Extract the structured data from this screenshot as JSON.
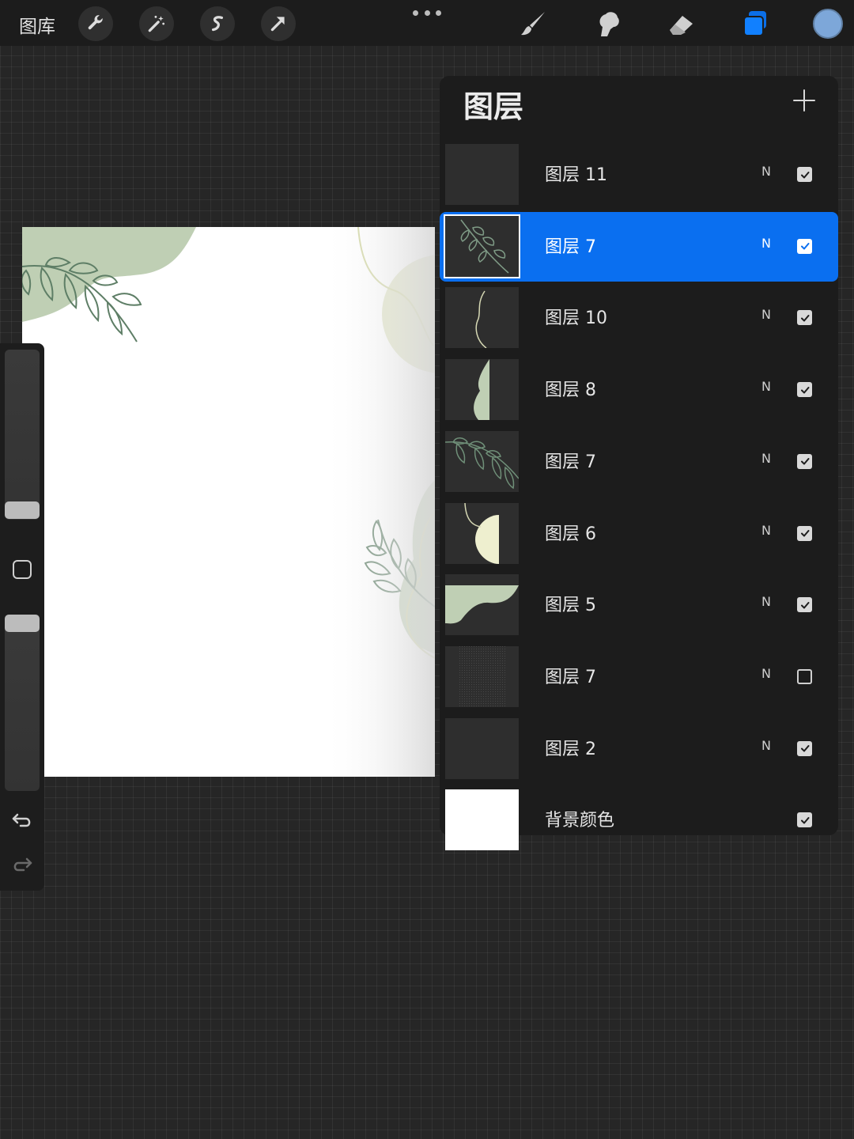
{
  "toolbar": {
    "gallery_label": "图库",
    "tools": [
      "wrench-icon",
      "magic-wand-icon",
      "selection-icon",
      "transform-arrow-icon"
    ],
    "more_icon": "more-dots-icon",
    "right_tools": [
      "brush-icon",
      "smudge-icon",
      "eraser-icon",
      "layers-icon"
    ],
    "current_color": "#7da7d9"
  },
  "layers_panel": {
    "title": "图层",
    "add_icon": "plus-icon",
    "layers": [
      {
        "name": "图层 11",
        "mode": "N",
        "visible": true,
        "selected": false,
        "thumb": "empty"
      },
      {
        "name": "图层 7",
        "mode": "N",
        "visible": true,
        "selected": true,
        "thumb": "leaf-small"
      },
      {
        "name": "图层 10",
        "mode": "N",
        "visible": true,
        "selected": false,
        "thumb": "line"
      },
      {
        "name": "图层 8",
        "mode": "N",
        "visible": true,
        "selected": false,
        "thumb": "shape-half"
      },
      {
        "name": "图层 7",
        "mode": "N",
        "visible": true,
        "selected": false,
        "thumb": "leaves"
      },
      {
        "name": "图层 6",
        "mode": "N",
        "visible": true,
        "selected": false,
        "thumb": "half-moon"
      },
      {
        "name": "图层 5",
        "mode": "N",
        "visible": true,
        "selected": false,
        "thumb": "wave"
      },
      {
        "name": "图层 7",
        "mode": "N",
        "visible": false,
        "selected": false,
        "thumb": "texture"
      },
      {
        "name": "图层 2",
        "mode": "N",
        "visible": true,
        "selected": false,
        "thumb": "empty"
      },
      {
        "name": "背景颜色",
        "mode": "",
        "visible": true,
        "selected": false,
        "thumb": "white"
      }
    ]
  },
  "colors": {
    "accent": "#0a6ff0",
    "sage": "#bfcfb4",
    "pale_olive": "#dfe3c3",
    "leaf_stroke": "#5e7e66"
  }
}
